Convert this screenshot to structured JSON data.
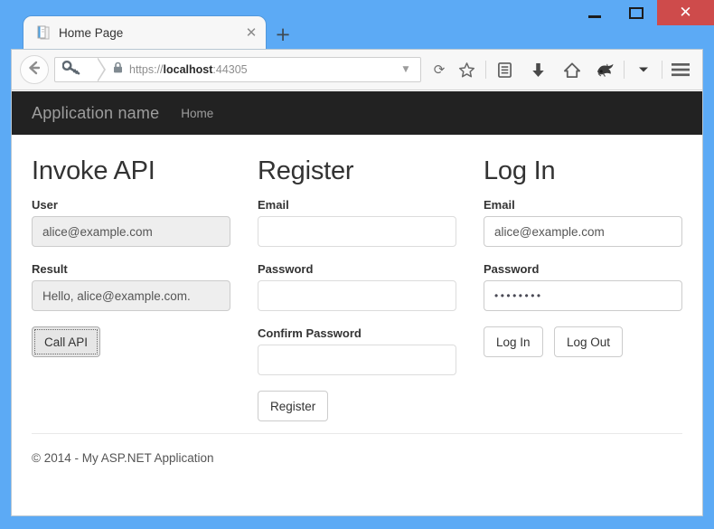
{
  "window": {
    "controls": {
      "minimize": "minimize-button",
      "maximize": "maximize-button",
      "close_glyph": "✕"
    }
  },
  "browser": {
    "tab": {
      "title": "Home Page",
      "close_glyph": "✕",
      "favicon": "page-icon"
    },
    "new_tab_glyph": "+",
    "back_glyph": "←",
    "url": {
      "scheme": "https://",
      "host": "localhost",
      "port": ":44305",
      "full": "https://localhost:44305"
    },
    "identity_icon": "key-icon",
    "lock_icon": "lock-icon",
    "urlbar_dropdown_glyph": "▼",
    "reload_glyph": "⟳",
    "toolbar_icons": [
      "bookmark-star-icon",
      "reader-list-icon",
      "downloads-arrow-icon",
      "home-icon",
      "addon-fox-icon",
      "overflow-chevron-icon",
      "hamburger-menu-icon"
    ]
  },
  "app": {
    "brand": "Application name",
    "nav": [
      {
        "label": "Home"
      }
    ],
    "columns": [
      {
        "heading": "Invoke API",
        "fields": [
          {
            "label": "User",
            "value": "alice@example.com",
            "style": "readonly"
          },
          {
            "label": "Result",
            "value": "Hello, alice@example.com.",
            "style": "readonly"
          }
        ],
        "buttons": [
          {
            "label": "Call API",
            "state": "pressed"
          }
        ]
      },
      {
        "heading": "Register",
        "fields": [
          {
            "label": "Email",
            "value": "",
            "style": "empty"
          },
          {
            "label": "Password",
            "value": "",
            "style": "empty"
          },
          {
            "label": "Confirm Password",
            "value": "",
            "style": "empty"
          }
        ],
        "buttons": [
          {
            "label": "Register",
            "state": "normal"
          }
        ]
      },
      {
        "heading": "Log In",
        "fields": [
          {
            "label": "Email",
            "value": "alice@example.com",
            "style": "normal"
          },
          {
            "label": "Password",
            "value": "••••••••",
            "style": "password"
          }
        ],
        "buttons": [
          {
            "label": "Log In",
            "state": "normal"
          },
          {
            "label": "Log Out",
            "state": "normal"
          }
        ]
      }
    ],
    "footer": "© 2014 - My ASP.NET Application"
  },
  "colors": {
    "frame": "#5caaf5",
    "close_button": "#ce4b4b",
    "navbar": "#222222",
    "readonly_input": "#eeeeee"
  }
}
